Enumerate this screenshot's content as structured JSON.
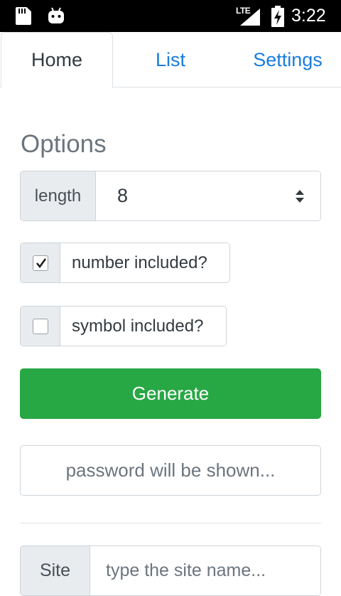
{
  "status_bar": {
    "network": "LTE",
    "time": "3:22",
    "icons": [
      "sd-card-icon",
      "android-icon",
      "signal-icon",
      "battery-charging-icon"
    ]
  },
  "tabs": [
    {
      "label": "Home",
      "active": true
    },
    {
      "label": "List",
      "active": false
    },
    {
      "label": "Settings",
      "active": false
    }
  ],
  "options": {
    "title": "Options",
    "length_label": "length",
    "length_value": "8",
    "number_label": "number included?",
    "number_checked": true,
    "symbol_label": "symbol included?",
    "symbol_checked": false
  },
  "generate_label": "Generate",
  "password_placeholder": "password will be shown...",
  "site": {
    "label": "Site",
    "placeholder": "type the site name..."
  },
  "colors": {
    "accent_link": "#1a7ce0",
    "success": "#28a745",
    "muted": "#6c757d"
  }
}
